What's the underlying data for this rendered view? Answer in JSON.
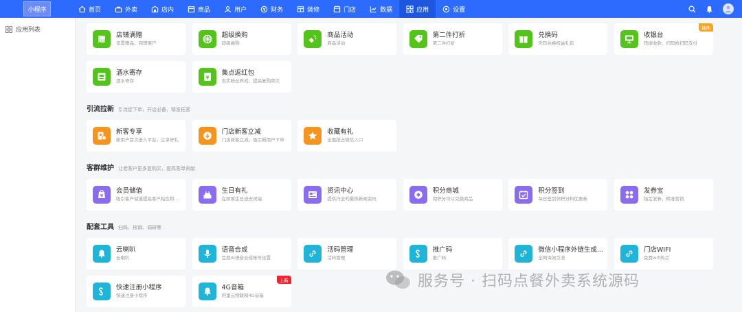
{
  "app": {
    "logo_text": "小程序"
  },
  "colors": {
    "topbar": "#2d6bff",
    "accent_green": "#52c41a",
    "accent_orange": "#f7941d",
    "accent_purple": "#8a6cf0",
    "accent_cyan": "#1fb5d8"
  },
  "nav": [
    {
      "label": "首页",
      "icon": "home-icon"
    },
    {
      "label": "外卖",
      "icon": "takeout-icon"
    },
    {
      "label": "店内",
      "icon": "store-inside-icon"
    },
    {
      "label": "商品",
      "icon": "product-icon"
    },
    {
      "label": "用户",
      "icon": "user-icon"
    },
    {
      "label": "财务",
      "icon": "finance-icon"
    },
    {
      "label": "装修",
      "icon": "decorate-icon"
    },
    {
      "label": "门店",
      "icon": "shop-icon"
    },
    {
      "label": "数据",
      "icon": "chart-icon"
    },
    {
      "label": "应用",
      "icon": "apps-icon",
      "active": true
    },
    {
      "label": "设置",
      "icon": "gear-icon"
    }
  ],
  "sidebar": {
    "items": [
      {
        "label": "应用列表",
        "icon": "grid-icon"
      }
    ]
  },
  "sections": [
    {
      "title": "",
      "desc": "",
      "cards": [
        {
          "title": "店铺满赠",
          "sub": "设置赠品，回馈用户",
          "color": "green",
          "icon": "gift-icon"
        },
        {
          "title": "超级换购",
          "sub": "超级换购",
          "color": "green",
          "icon": "exchange-icon"
        },
        {
          "title": "商品活动",
          "sub": "商品活动",
          "color": "green",
          "icon": "megaphone-icon"
        },
        {
          "title": "第二件打折",
          "sub": "第二件打折",
          "color": "green",
          "icon": "tag-icon"
        },
        {
          "title": "兑换码",
          "sub": "凭码兑换权益礼包",
          "color": "green",
          "icon": "gift-box-icon"
        },
        {
          "title": "收银台",
          "sub": "快捷收款、扫码枪扫码支付",
          "color": "green",
          "icon": "cashier-icon",
          "tag": "插件"
        },
        {
          "title": "酒水寄存",
          "sub": "酒水寄存",
          "color": "green",
          "icon": "storage-icon"
        },
        {
          "title": "集点返红包",
          "sub": "忠实粉丝养成、提高复购频次",
          "color": "green",
          "icon": "red-packet-icon"
        }
      ]
    },
    {
      "title": "引流拉新",
      "desc": "引流促下单，开店必备，精准拓客",
      "cards": [
        {
          "title": "新客专享",
          "sub": "新用户首次进入平台，立享好礼",
          "color": "orange",
          "icon": "new-customer-icon"
        },
        {
          "title": "门店新客立减",
          "sub": "门店新客立减，吸引新用户下单",
          "color": "orange",
          "icon": "discount-icon"
        },
        {
          "title": "收藏有礼",
          "sub": "全面抢占微信入口",
          "color": "orange",
          "icon": "star-icon"
        }
      ]
    },
    {
      "title": "客群维护",
      "desc": "让老客户更多复购买，提高客单贡献",
      "cards": [
        {
          "title": "会员储值",
          "sub": "吸引客户储值提高客户粘性和...",
          "color": "purple",
          "icon": "wallet-icon"
        },
        {
          "title": "生日有礼",
          "sub": "在顾客生日送去祝福",
          "color": "purple",
          "icon": "cake-icon"
        },
        {
          "title": "资讯中心",
          "sub": "提供行业的最热新闻资讯",
          "color": "purple",
          "icon": "news-icon"
        },
        {
          "title": "积分商城",
          "sub": "用积分可以兑换商品",
          "color": "purple",
          "icon": "points-mall-icon"
        },
        {
          "title": "积分签到",
          "sub": "每日签到领积分和优惠券",
          "color": "purple",
          "icon": "calendar-check-icon"
        },
        {
          "title": "发券宝",
          "sub": "指定发券，精准营销",
          "color": "purple",
          "icon": "coupon-icon"
        }
      ]
    },
    {
      "title": "配套工具",
      "desc": "扫码、核销、调研等",
      "cards": [
        {
          "title": "云喇叭",
          "sub": "云喇叭",
          "color": "cyan",
          "icon": "bell-icon"
        },
        {
          "title": "语音合成",
          "sub": "百度AI语音合成账号设置",
          "color": "cyan",
          "icon": "microphone-icon"
        },
        {
          "title": "活码管理",
          "sub": "活码管理",
          "color": "cyan",
          "icon": "link-icon"
        },
        {
          "title": "推广码",
          "sub": "推广码",
          "color": "cyan",
          "icon": "miniapp-icon"
        },
        {
          "title": "微信小程序外链生成...",
          "sub": "全网海效引流",
          "color": "cyan",
          "icon": "link-icon"
        },
        {
          "title": "门店WIFI",
          "sub": "免费wifi热点",
          "color": "cyan",
          "icon": "link-icon"
        },
        {
          "title": "快速注册小程序",
          "sub": "快速注册小程序",
          "color": "cyan",
          "icon": "miniapp-icon"
        },
        {
          "title": "4G音箱",
          "sub": "阿里云物联网4G音箱",
          "color": "cyan",
          "icon": "bell-icon",
          "tag": "上新",
          "tag_color": "red"
        }
      ]
    }
  ],
  "watermark": {
    "text": "服务号 · 扫码点餐外卖系统源码"
  }
}
